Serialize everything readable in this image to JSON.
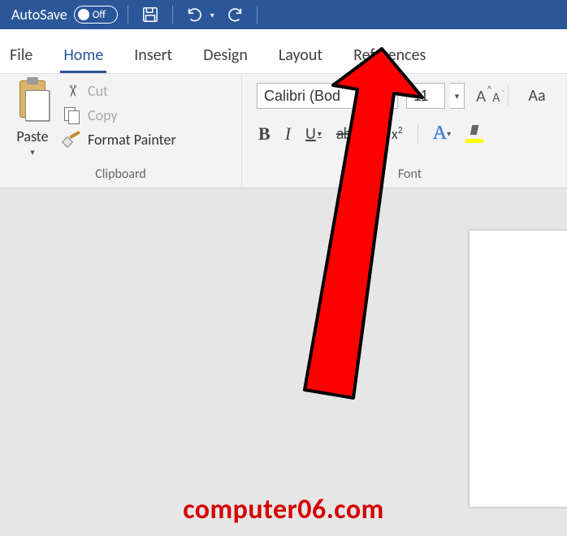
{
  "titlebar": {
    "autosave_label": "AutoSave",
    "autosave_state": "Off"
  },
  "tabs": {
    "file": "File",
    "home": "Home",
    "insert": "Insert",
    "design": "Design",
    "layout": "Layout",
    "references": "References"
  },
  "clipboard": {
    "paste": "Paste",
    "cut": "Cut",
    "copy": "Copy",
    "format_painter": "Format Painter",
    "group_label": "Clipboard"
  },
  "font": {
    "name_value": "Calibri (Bod",
    "size_value": "11",
    "change_case": "Aa",
    "bold": "B",
    "italic": "I",
    "underline": "U",
    "strike": "ab",
    "subscript_base": "x",
    "superscript_base": "x",
    "text_effects": "A",
    "group_label": "Font"
  },
  "watermark": "computer06.com",
  "colors": {
    "word_blue": "#2b579a",
    "arrow_red": "#ff0000",
    "highlight_yellow": "#ffff00"
  }
}
